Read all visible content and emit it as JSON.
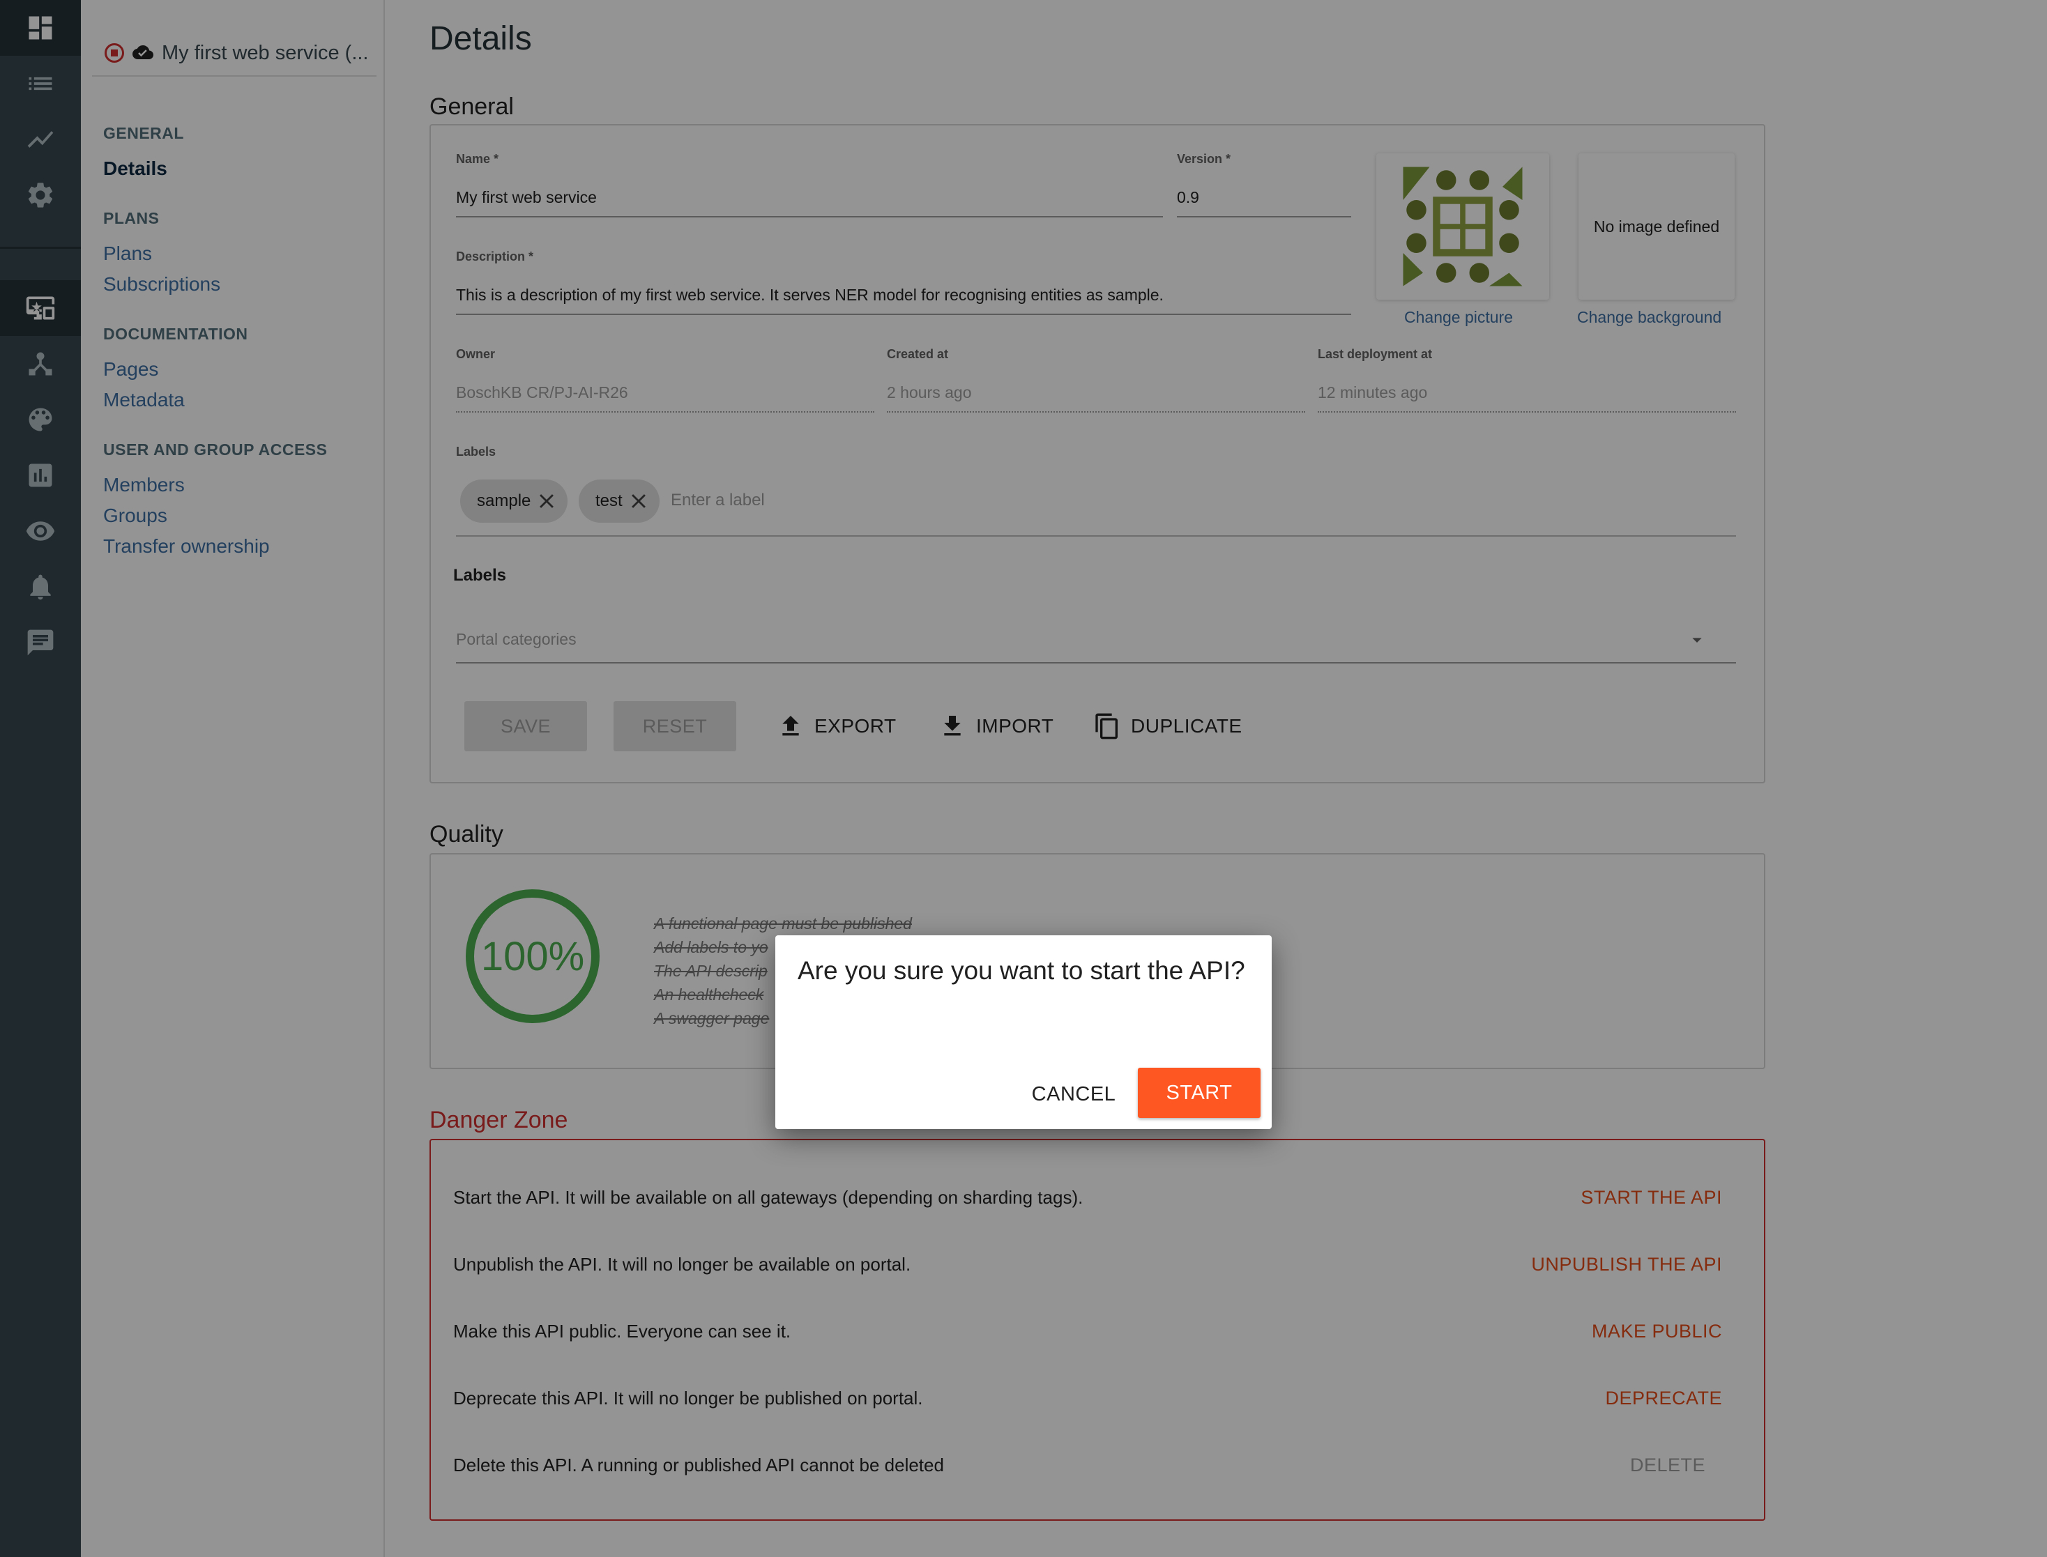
{
  "rail": {
    "icons": [
      "dashboard-icon",
      "list-icon",
      "analytics-icon",
      "settings-icon",
      "api-portal-icon",
      "hierarchy-icon",
      "palette-icon",
      "bar-chart-icon",
      "eye-icon",
      "bell-icon",
      "message-icon"
    ],
    "active": [
      "dashboard-icon",
      "api-portal-icon"
    ]
  },
  "sidebar": {
    "api_title": "My first web service (...",
    "groups": [
      {
        "title": "GENERAL",
        "items": [
          {
            "label": "Details",
            "current": true
          }
        ]
      },
      {
        "title": "PLANS",
        "items": [
          {
            "label": "Plans"
          },
          {
            "label": "Subscriptions"
          }
        ]
      },
      {
        "title": "DOCUMENTATION",
        "items": [
          {
            "label": "Pages"
          },
          {
            "label": "Metadata"
          }
        ]
      },
      {
        "title": "USER AND GROUP ACCESS",
        "items": [
          {
            "label": "Members"
          },
          {
            "label": "Groups"
          },
          {
            "label": "Transfer ownership"
          }
        ]
      }
    ]
  },
  "main": {
    "page_title": "Details",
    "general": {
      "title": "General",
      "name_label": "Name *",
      "name_value": "My first web service",
      "version_label": "Version *",
      "version_value": "0.9",
      "description_label": "Description *",
      "description_value": "This is a description of my first web service. It serves NER model for recognising entities as sample.",
      "change_picture": "Change picture",
      "no_image": "No image defined",
      "change_background": "Change background",
      "owner_label": "Owner",
      "owner_value": "BoschKB CR/PJ-AI-R26",
      "created_label": "Created at",
      "created_value": "2 hours ago",
      "deployed_label": "Last deployment at",
      "deployed_value": "12 minutes ago",
      "labels_label": "Labels",
      "chips": [
        "sample",
        "test"
      ],
      "label_placeholder": "Enter a label",
      "labels_heading": "Labels",
      "portal_categories": "Portal categories",
      "save": "SAVE",
      "reset": "RESET",
      "export": "EXPORT",
      "import": "IMPORT",
      "duplicate": "DUPLICATE"
    },
    "quality": {
      "title": "Quality",
      "score": "100%",
      "score_value": 100,
      "items": [
        "A functional page must be published",
        "Add labels to yo",
        "The API descrip",
        "An healthcheck",
        "A swagger page"
      ]
    },
    "danger": {
      "title": "Danger Zone",
      "rows": [
        {
          "text": "Start the API. It will be available on all gateways (depending on sharding tags).",
          "action": "START THE API"
        },
        {
          "text": "Unpublish the API. It will no longer be available on portal.",
          "action": "UNPUBLISH THE API"
        },
        {
          "text": "Make this API public. Everyone can see it.",
          "action": "MAKE PUBLIC"
        },
        {
          "text": "Deprecate this API. It will no longer be published on portal.",
          "action": "DEPRECATE"
        },
        {
          "text": "Delete this API. A running or published API cannot be deleted",
          "action": "DELETE"
        }
      ]
    }
  },
  "dialog": {
    "title": "Are you sure you want to start the API?",
    "cancel": "CANCEL",
    "confirm": "START"
  },
  "colors": {
    "accent": "#ff5722",
    "danger": "#d32f2f",
    "link": "#3f6fa4",
    "rail": "#37474f",
    "quality": "#4caf50"
  }
}
